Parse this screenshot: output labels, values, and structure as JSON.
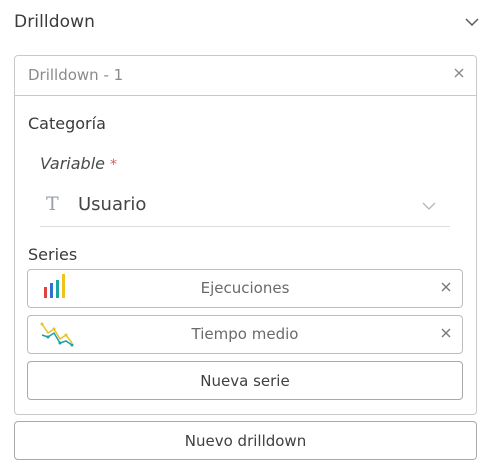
{
  "section": {
    "title": "Drilldown",
    "chevron_icon": "chevron-down-icon"
  },
  "drilldown": {
    "name": "Drilldown - 1",
    "close_icon": "close-icon",
    "category_label": "Categoría",
    "variable": {
      "label": "Variable",
      "required_mark": "*",
      "type_icon_glyph": "T",
      "value": "Usuario",
      "dropdown_icon": "chevron-down-icon"
    },
    "series_label": "Series",
    "series": [
      {
        "label": "Ejecuciones",
        "icon": "bar-chart-icon",
        "close_icon": "close-icon"
      },
      {
        "label": "Tiempo medio",
        "icon": "line-chart-icon",
        "close_icon": "close-icon"
      }
    ],
    "new_series_label": "Nueva serie"
  },
  "new_drilldown_label": "Nuevo drilldown",
  "colors": {
    "border": "#c9c9c9",
    "required": "#e15a5a",
    "bar_red": "#e0433b",
    "bar_blue": "#2f6fd6",
    "bar_teal": "#1aa6a0",
    "bar_yellow": "#f1c21b",
    "line_teal": "#16a3a8",
    "line_yellow": "#e8c02a"
  }
}
